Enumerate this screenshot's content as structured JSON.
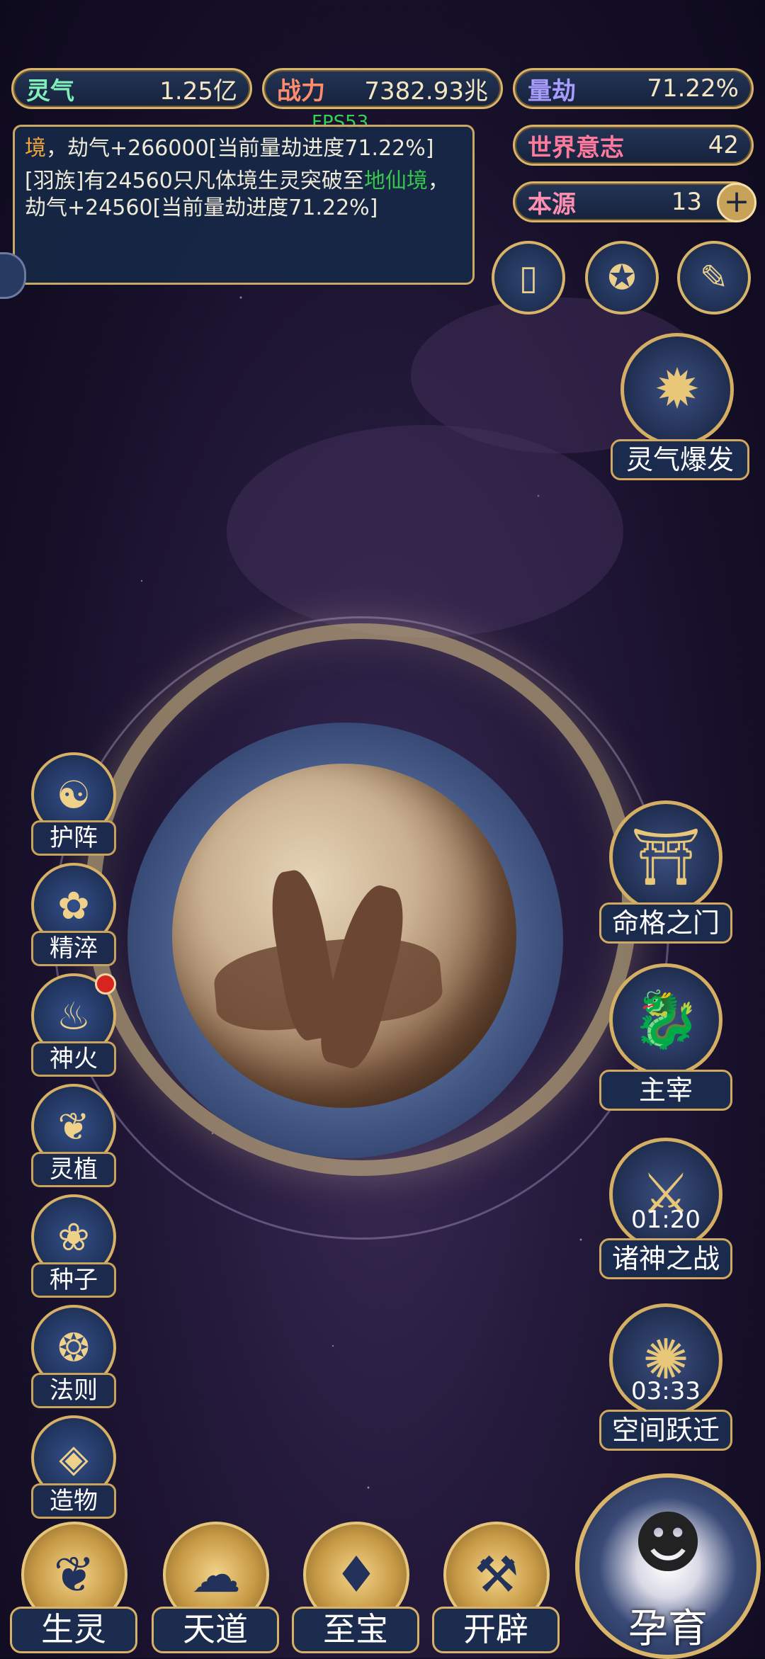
{
  "top_bar": {
    "lingqi": {
      "label": "灵气",
      "value": "1.25亿"
    },
    "zhanli": {
      "label": "战力",
      "value": "7382.93兆"
    },
    "liangjie": {
      "label": "量劫",
      "value": "71.22%"
    }
  },
  "fps": "FPS53",
  "right_stats": {
    "world_will": {
      "label": "世界意志",
      "value": "42"
    },
    "benyuan": {
      "label": "本源",
      "value": "13"
    }
  },
  "log": {
    "line1_prefix": "境",
    "line1_rest": "，劫气+266000[当前量劫进度71.22%]",
    "line2_part1": "[羽族]有24560只凡体境生灵突破至",
    "line2_highlight": "地仙境",
    "line2_part2": "，劫气+24560[当前量劫进度71.22%]"
  },
  "top_icons": [
    "card-icon",
    "vortex-icon",
    "scroll-icon"
  ],
  "lingqi_burst": {
    "label": "灵气爆发"
  },
  "left_menu": [
    {
      "label": "护阵",
      "icon": "yinyang-icon",
      "glyph": "☯"
    },
    {
      "label": "精淬",
      "icon": "lotus-icon",
      "glyph": "✿"
    },
    {
      "label": "神火",
      "icon": "flame-icon",
      "glyph": "♨",
      "badge": true
    },
    {
      "label": "灵植",
      "icon": "plant-icon",
      "glyph": "❦"
    },
    {
      "label": "种子",
      "icon": "flower-icon",
      "glyph": "❀"
    },
    {
      "label": "法则",
      "icon": "rune-icon",
      "glyph": "❂"
    },
    {
      "label": "造物",
      "icon": "diamond-icon",
      "glyph": "◈"
    }
  ],
  "right_menu": [
    {
      "label": "命格之门",
      "icon": "gate-icon",
      "glyph": "⛩"
    },
    {
      "label": "主宰",
      "icon": "dragon-icon",
      "glyph": "🐉"
    },
    {
      "label": "诸神之战",
      "icon": "sword-icon",
      "glyph": "⚔",
      "timer": "01:20"
    },
    {
      "label": "空间跃迁",
      "icon": "swirl-icon",
      "glyph": "✺",
      "timer": "03:33"
    }
  ],
  "bottom_menu": [
    {
      "label": "生灵",
      "icon": "phoenix-icon",
      "glyph": "❦"
    },
    {
      "label": "天道",
      "icon": "cloud-swirl-icon",
      "glyph": "☁"
    },
    {
      "label": "至宝",
      "icon": "treasure-icon",
      "glyph": "♦"
    },
    {
      "label": "开辟",
      "icon": "axe-icon",
      "glyph": "⚒"
    }
  ],
  "nurture": {
    "label": "孕育",
    "icon": "embryo-icon",
    "glyph": "☻"
  },
  "colors": {
    "gold": "#d8b46a",
    "panel": "#1c2b4d",
    "fps": "#33d155",
    "highlight_green": "#33c84a",
    "highlight_orange": "#f0a53a"
  }
}
